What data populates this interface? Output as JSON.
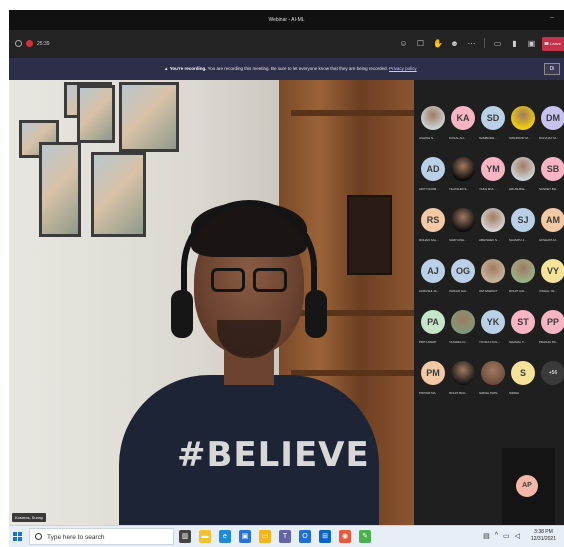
{
  "window": {
    "title": "Webinar - AI-ML",
    "minimize_glyph": "–"
  },
  "meeting_bar": {
    "timer": "25:39",
    "leave_label": "Leave",
    "controls": [
      "participants-icon",
      "chat-icon",
      "raise-hand-icon",
      "reactions-icon",
      "more-icon",
      "camera-icon",
      "mic-icon",
      "share-icon"
    ]
  },
  "recording_banner": {
    "bold": "You're recording.",
    "text": " You are recording this meeting. Be sure to let everyone know that they are being recorded.",
    "link": "Privacy policy",
    "dismiss": "Di"
  },
  "video": {
    "shirt_text": "#BELIEVE",
    "name_tag": "Kosmos, Sunny"
  },
  "participants": [
    {
      "initials": "",
      "photo": true,
      "name": "ASHISH N...",
      "color": "#cfd8dc"
    },
    {
      "initials": "KA",
      "photo": false,
      "name": "KUNAL AH...",
      "color": "#f7b4c3"
    },
    {
      "initials": "SD",
      "photo": false,
      "name": "SAMBODH...",
      "color": "#b9d0e6"
    },
    {
      "initials": "",
      "photo": true,
      "name": "SWAROOP M...",
      "color": "#f2d40a"
    },
    {
      "initials": "DM",
      "photo": false,
      "name": "DIGVIJAY M...",
      "color": "#c8c3ee"
    },
    {
      "initials": "AD",
      "photo": false,
      "name": "ADITI DHOB...",
      "color": "#b9d0e6"
    },
    {
      "initials": "",
      "photo": true,
      "name": "TEJASHRI S...",
      "color": "#050505"
    },
    {
      "initials": "YM",
      "photo": false,
      "name": "YASH MUL...",
      "color": "#f7b4c3"
    },
    {
      "initials": "",
      "photo": true,
      "name": "HRUSHIKE...",
      "color": "#cfd8dc"
    },
    {
      "initials": "SB",
      "photo": false,
      "name": "SANKET BH...",
      "color": "#f7b4c3"
    },
    {
      "initials": "RS",
      "photo": false,
      "name": "ROHAN SAL...",
      "color": "#f2c9a4"
    },
    {
      "initials": "",
      "photo": true,
      "name": "SHRIYASH...",
      "color": "#0a0a0a"
    },
    {
      "initials": "",
      "photo": true,
      "name": "ABHISHEK S...",
      "color": "#d9d9d9"
    },
    {
      "initials": "SJ",
      "photo": false,
      "name": "SHAMPU J...",
      "color": "#b9d0e6"
    },
    {
      "initials": "AM",
      "photo": false,
      "name": "AKSHATA M...",
      "color": "#f2c9a4"
    },
    {
      "initials": "AJ",
      "photo": false,
      "name": "AARUSHI JA...",
      "color": "#b9d0e6"
    },
    {
      "initials": "OG",
      "photo": false,
      "name": "OMKAR GAI...",
      "color": "#b9d0e6"
    },
    {
      "initials": "",
      "photo": true,
      "name": "OM SAWANT",
      "color": "#c9b7a0"
    },
    {
      "initials": "",
      "photo": true,
      "name": "ROHIT KAL...",
      "color": "#9ab58a"
    },
    {
      "initials": "VY",
      "photo": false,
      "name": "VISHAL YE...",
      "color": "#f5e39a"
    },
    {
      "initials": "PA",
      "photo": false,
      "name": "PRITI AWATI",
      "color": "#c5e6c9"
    },
    {
      "initials": "",
      "photo": true,
      "name": "YASHRAJ K...",
      "color": "#7e9b7a"
    },
    {
      "initials": "YK",
      "photo": false,
      "name": "YUVRAJ KOL...",
      "color": "#b9d0e6"
    },
    {
      "initials": "ST",
      "photo": false,
      "name": "SHAMAL T...",
      "color": "#f7b4c3"
    },
    {
      "initials": "PP",
      "photo": false,
      "name": "PRANAV PA...",
      "color": "#f7b4c3"
    },
    {
      "initials": "PM",
      "photo": false,
      "name": "PRITAM MA...",
      "color": "#f2c9a4"
    },
    {
      "initials": "",
      "photo": true,
      "name": "ROHIT BAG...",
      "color": "#111111"
    },
    {
      "initials": "",
      "photo": true,
      "name": "GIRISH PATIL",
      "color": "#6b4a3a"
    },
    {
      "initials": "S",
      "photo": false,
      "name": "SIDDHI",
      "color": "#f5e39a"
    }
  ],
  "more_participants": "+56",
  "self_view": {
    "initials": "AP"
  },
  "taskbar": {
    "search_placeholder": "Type here to search",
    "time": "3:38 PM",
    "date": "12/31/2021"
  }
}
